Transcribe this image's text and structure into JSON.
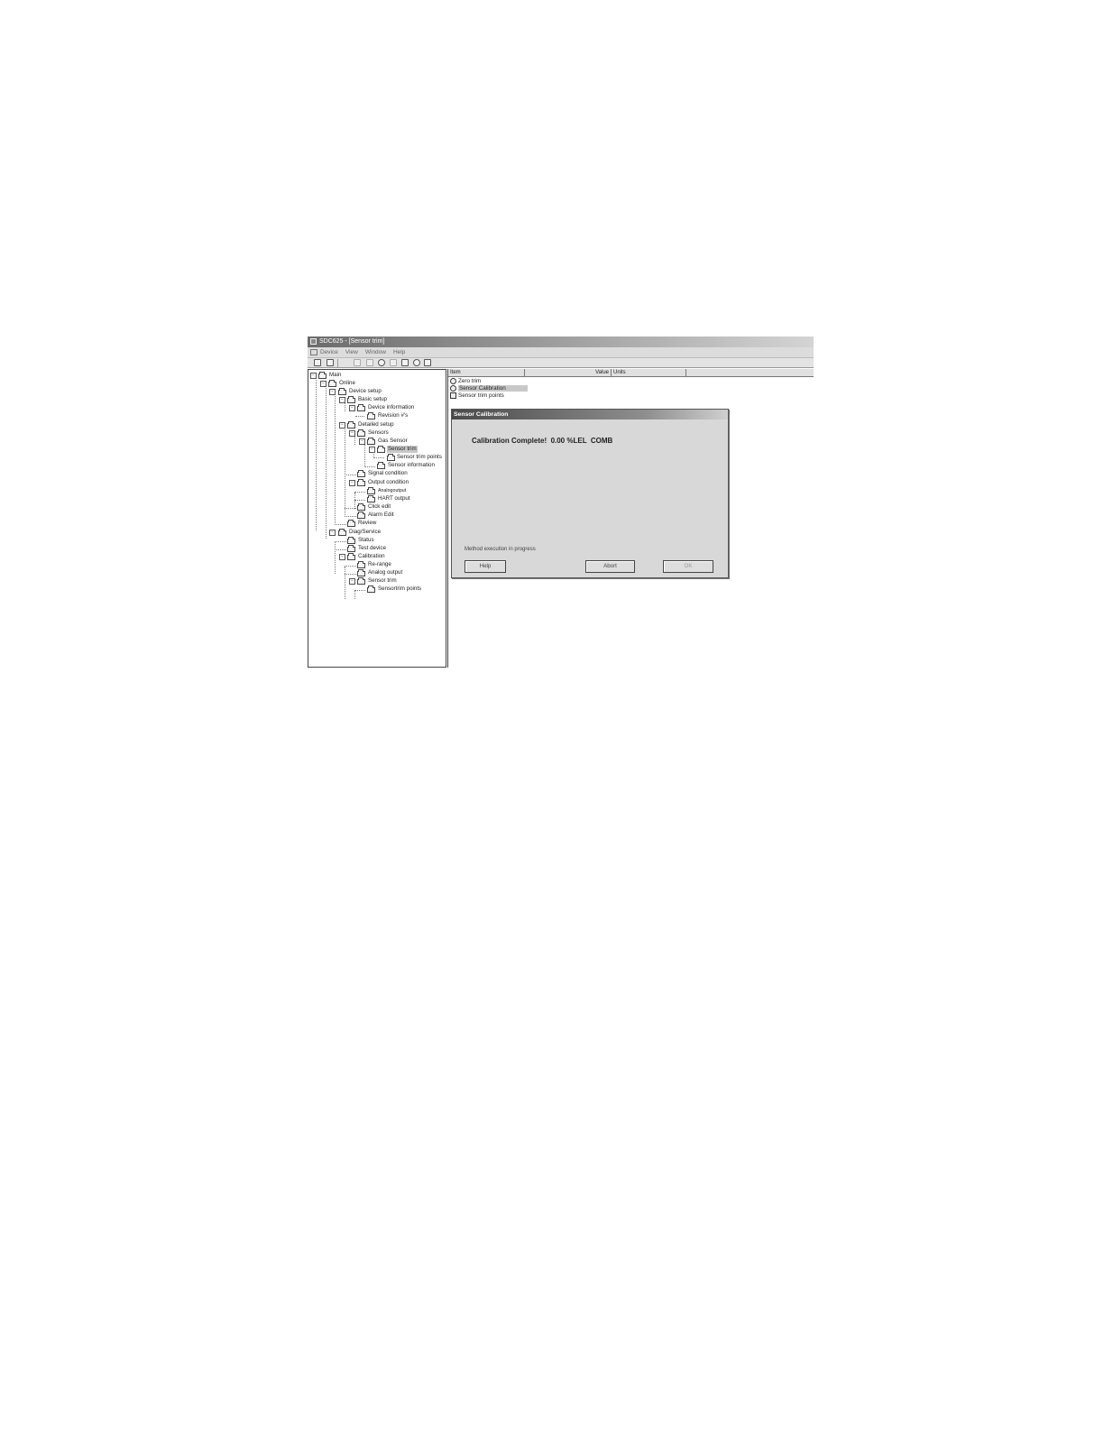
{
  "window": {
    "title": "SDC625 - [Sensor trim]",
    "menu": [
      "Device",
      "View",
      "Window",
      "Help"
    ]
  },
  "tree": [
    {
      "label": "Main",
      "expander": "−"
    },
    {
      "label": "Online",
      "expander": "−"
    },
    {
      "label": "Device setup",
      "expander": "−"
    },
    {
      "label": "Basic setup",
      "expander": "−"
    },
    {
      "label": "Device information",
      "expander": "−"
    },
    {
      "label": "Revision #'s",
      "expander": ""
    },
    {
      "label": "Detailed setup",
      "expander": "−"
    },
    {
      "label": "Sensors",
      "expander": "−"
    },
    {
      "label": "Gas Sensor",
      "expander": "−"
    },
    {
      "label": "Sensor trim",
      "expander": "−"
    },
    {
      "label": "Sensor trim points",
      "expander": ""
    },
    {
      "label": "Sensor information",
      "expander": ""
    },
    {
      "label": "Signal condition",
      "expander": ""
    },
    {
      "label": "Output condition",
      "expander": "−"
    },
    {
      "label": "Analogoutput",
      "expander": ""
    },
    {
      "label": "HART output",
      "expander": ""
    },
    {
      "label": "Click edit",
      "expander": ""
    },
    {
      "label": "Alarm Edit",
      "expander": ""
    },
    {
      "label": "Review",
      "expander": ""
    },
    {
      "label": "Diag/Service",
      "expander": "−"
    },
    {
      "label": "Status",
      "expander": ""
    },
    {
      "label": "Test device",
      "expander": ""
    },
    {
      "label": "Calibration",
      "expander": "−"
    },
    {
      "label": "Re-range",
      "expander": ""
    },
    {
      "label": "Analog output",
      "expander": ""
    },
    {
      "label": "Sensor trim",
      "expander": "−"
    },
    {
      "label": "Sensortrim points",
      "expander": ""
    }
  ],
  "list": {
    "columns": [
      "Item",
      "Value",
      "Units"
    ],
    "items": [
      "Zero trim",
      "Sensor Calibration",
      "Sensor trim points"
    ]
  },
  "dialog": {
    "title": "Sensor Calibration",
    "message": "Calibration Complete!  0.00 %LEL  COMB",
    "status": "Method execution in progress",
    "buttons": {
      "help": "Help",
      "abort": "Abort",
      "ok": "OK"
    }
  }
}
